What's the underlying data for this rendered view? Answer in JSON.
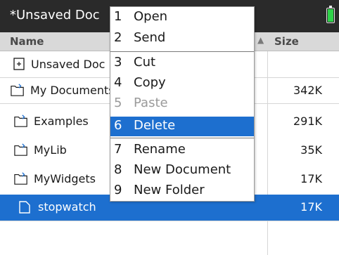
{
  "titlebar": {
    "title": "*Unsaved Doc",
    "battery_icon": "battery-full-icon",
    "battery_color": "#2fd24a"
  },
  "columns": {
    "name": "Name",
    "size": "Size",
    "sort_icon": "sort-ascending-arrow-icon"
  },
  "files": [
    {
      "name": "Unsaved Doc",
      "size": "",
      "icon": "document-icon",
      "selected": false
    },
    {
      "name": "My Documents",
      "size": "342K",
      "icon": "folder-icon",
      "selected": false
    },
    {
      "name": "Examples",
      "size": "291K",
      "icon": "folder-icon",
      "selected": false
    },
    {
      "name": "MyLib",
      "size": "35K",
      "icon": "folder-icon",
      "selected": false
    },
    {
      "name": "MyWidgets",
      "size": "17K",
      "icon": "folder-icon",
      "selected": false
    },
    {
      "name": "stopwatch",
      "size": "17K",
      "icon": "document-icon",
      "selected": true
    }
  ],
  "context_menu": {
    "items": [
      {
        "number": "1",
        "label": "Open",
        "enabled": true,
        "highlighted": false
      },
      {
        "number": "2",
        "label": "Send",
        "enabled": true,
        "highlighted": false
      },
      {
        "number": "3",
        "label": "Cut",
        "enabled": true,
        "highlighted": false
      },
      {
        "number": "4",
        "label": "Copy",
        "enabled": true,
        "highlighted": false
      },
      {
        "number": "5",
        "label": "Paste",
        "enabled": false,
        "highlighted": false
      },
      {
        "number": "6",
        "label": "Delete",
        "enabled": true,
        "highlighted": true
      },
      {
        "number": "7",
        "label": "Rename",
        "enabled": true,
        "highlighted": false
      },
      {
        "number": "8",
        "label": "New Document",
        "enabled": true,
        "highlighted": false
      },
      {
        "number": "9",
        "label": "New Folder",
        "enabled": true,
        "highlighted": false
      }
    ]
  },
  "colors": {
    "selection": "#1d6fcf",
    "titlebar": "#2a2a2a",
    "header": "#d9d9d9"
  }
}
